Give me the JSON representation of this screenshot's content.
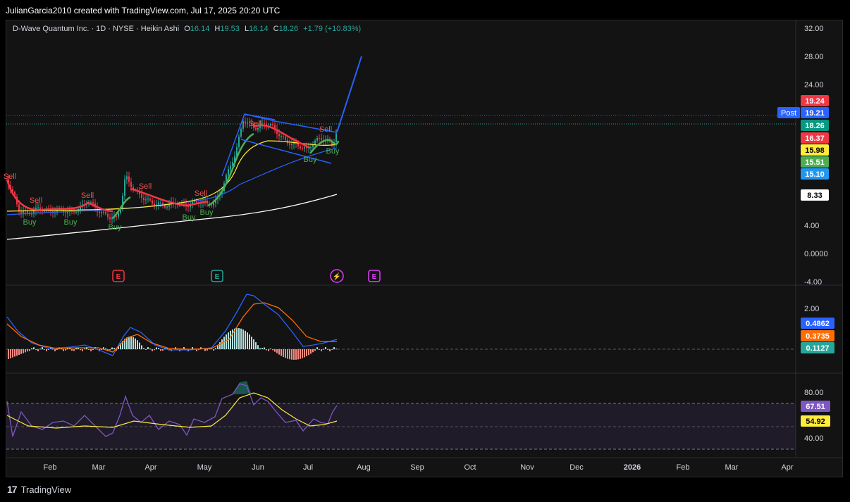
{
  "header": {
    "credit": "JulianGarcia2010 created with TradingView.com, Jul 17, 2025 20:20 UTC"
  },
  "legend": {
    "symbol": "D-Wave Quantum Inc. · 1D · NYSE · Heikin Ashi",
    "o_label": "O",
    "o": "16.14",
    "h_label": "H",
    "h": "19.53",
    "l_label": "L",
    "l": "16.14",
    "c_label": "C",
    "c": "18.26",
    "change": "+1.79 (+10.83%)"
  },
  "price_axis": {
    "ticks": [
      "32.00",
      "28.00",
      "24.00",
      "4.00",
      "0.0000",
      "-4.00"
    ],
    "badges": [
      {
        "text": "19.24",
        "color": "#f23645"
      },
      {
        "text": "19.21",
        "color": "#2962ff"
      },
      {
        "text": "18.26",
        "color": "#089981"
      },
      {
        "text": "16.37",
        "color": "#f23645"
      },
      {
        "text": "15.98",
        "color": "#ffeb3b"
      },
      {
        "text": "15.51",
        "color": "#4caf50"
      },
      {
        "text": "15.10",
        "color": "#2196f3"
      },
      {
        "text": "8.33",
        "color": "#ffffff"
      }
    ],
    "post_label": "Post"
  },
  "macd_axis": {
    "ticks": [
      "2.00"
    ],
    "badges": [
      {
        "text": "0.4862",
        "color": "#2962ff"
      },
      {
        "text": "0.3735",
        "color": "#ff6d00"
      },
      {
        "text": "0.1127",
        "color": "#26a69a"
      }
    ]
  },
  "rsi_axis": {
    "ticks": [
      "80.00",
      "40.00"
    ],
    "badges": [
      {
        "text": "67.51",
        "color": "#7e57c2"
      },
      {
        "text": "54.92",
        "color": "#ffeb3b"
      }
    ]
  },
  "time_axis": [
    "Feb",
    "Mar",
    "Apr",
    "May",
    "Jun",
    "Jul",
    "Aug",
    "Sep",
    "Oct",
    "Nov",
    "Dec",
    "2026",
    "Feb",
    "Mar",
    "Apr"
  ],
  "signals": {
    "buy": [
      "Buy",
      "Buy",
      "Buy",
      "Buy",
      "Buy",
      "Buy",
      "Buy"
    ],
    "sell": [
      "Sell",
      "Sell",
      "Sell",
      "Sell",
      "Sell",
      "Sell",
      "Sell"
    ]
  },
  "events": [
    "E",
    "E",
    "⚡",
    "E"
  ],
  "footer": {
    "brand": "TradingView"
  },
  "colors": {
    "bg": "#131313",
    "up": "#26a69a",
    "down": "#f23645",
    "ma_slow": "#ffffff",
    "ma_mid": "#2962ff",
    "ma_fast": "#ffeb3b",
    "trend": "#2962ff",
    "macd": "#2962ff",
    "signal": "#ff6d00",
    "rsi": "#7e57c2",
    "rsi_ma": "#ffeb3b"
  }
}
